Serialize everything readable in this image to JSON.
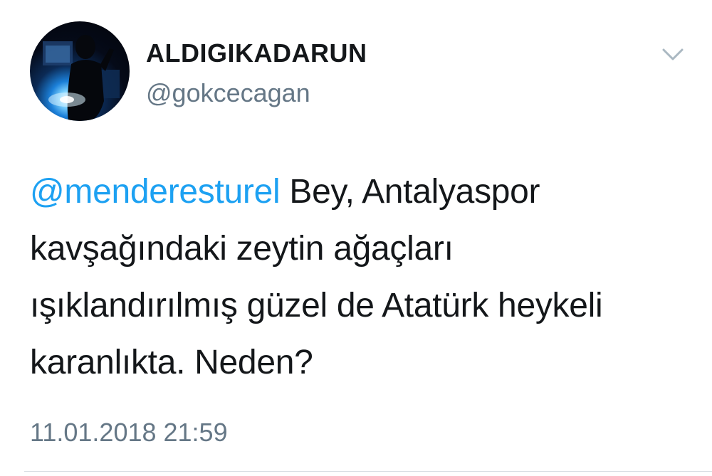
{
  "author": {
    "display_name": "ALDIGIKADARUN",
    "handle": "@gokcecagan"
  },
  "tweet": {
    "mention": "@menderesturel",
    "text_lines": [
      " Bey, Antalyaspor",
      "kavşağındaki zeytin ağaçları",
      "ışıklandırılmış güzel de Atatürk heykeli",
      "karanlıkta. Neden?"
    ],
    "timestamp": "11.01.2018 21:59"
  },
  "icons": {
    "menu": "chevron-down-icon",
    "avatar": "profile-photo"
  },
  "colors": {
    "link": "#1da1f2",
    "text": "#14171a",
    "secondary": "#657786",
    "divider": "#d7dde2"
  }
}
